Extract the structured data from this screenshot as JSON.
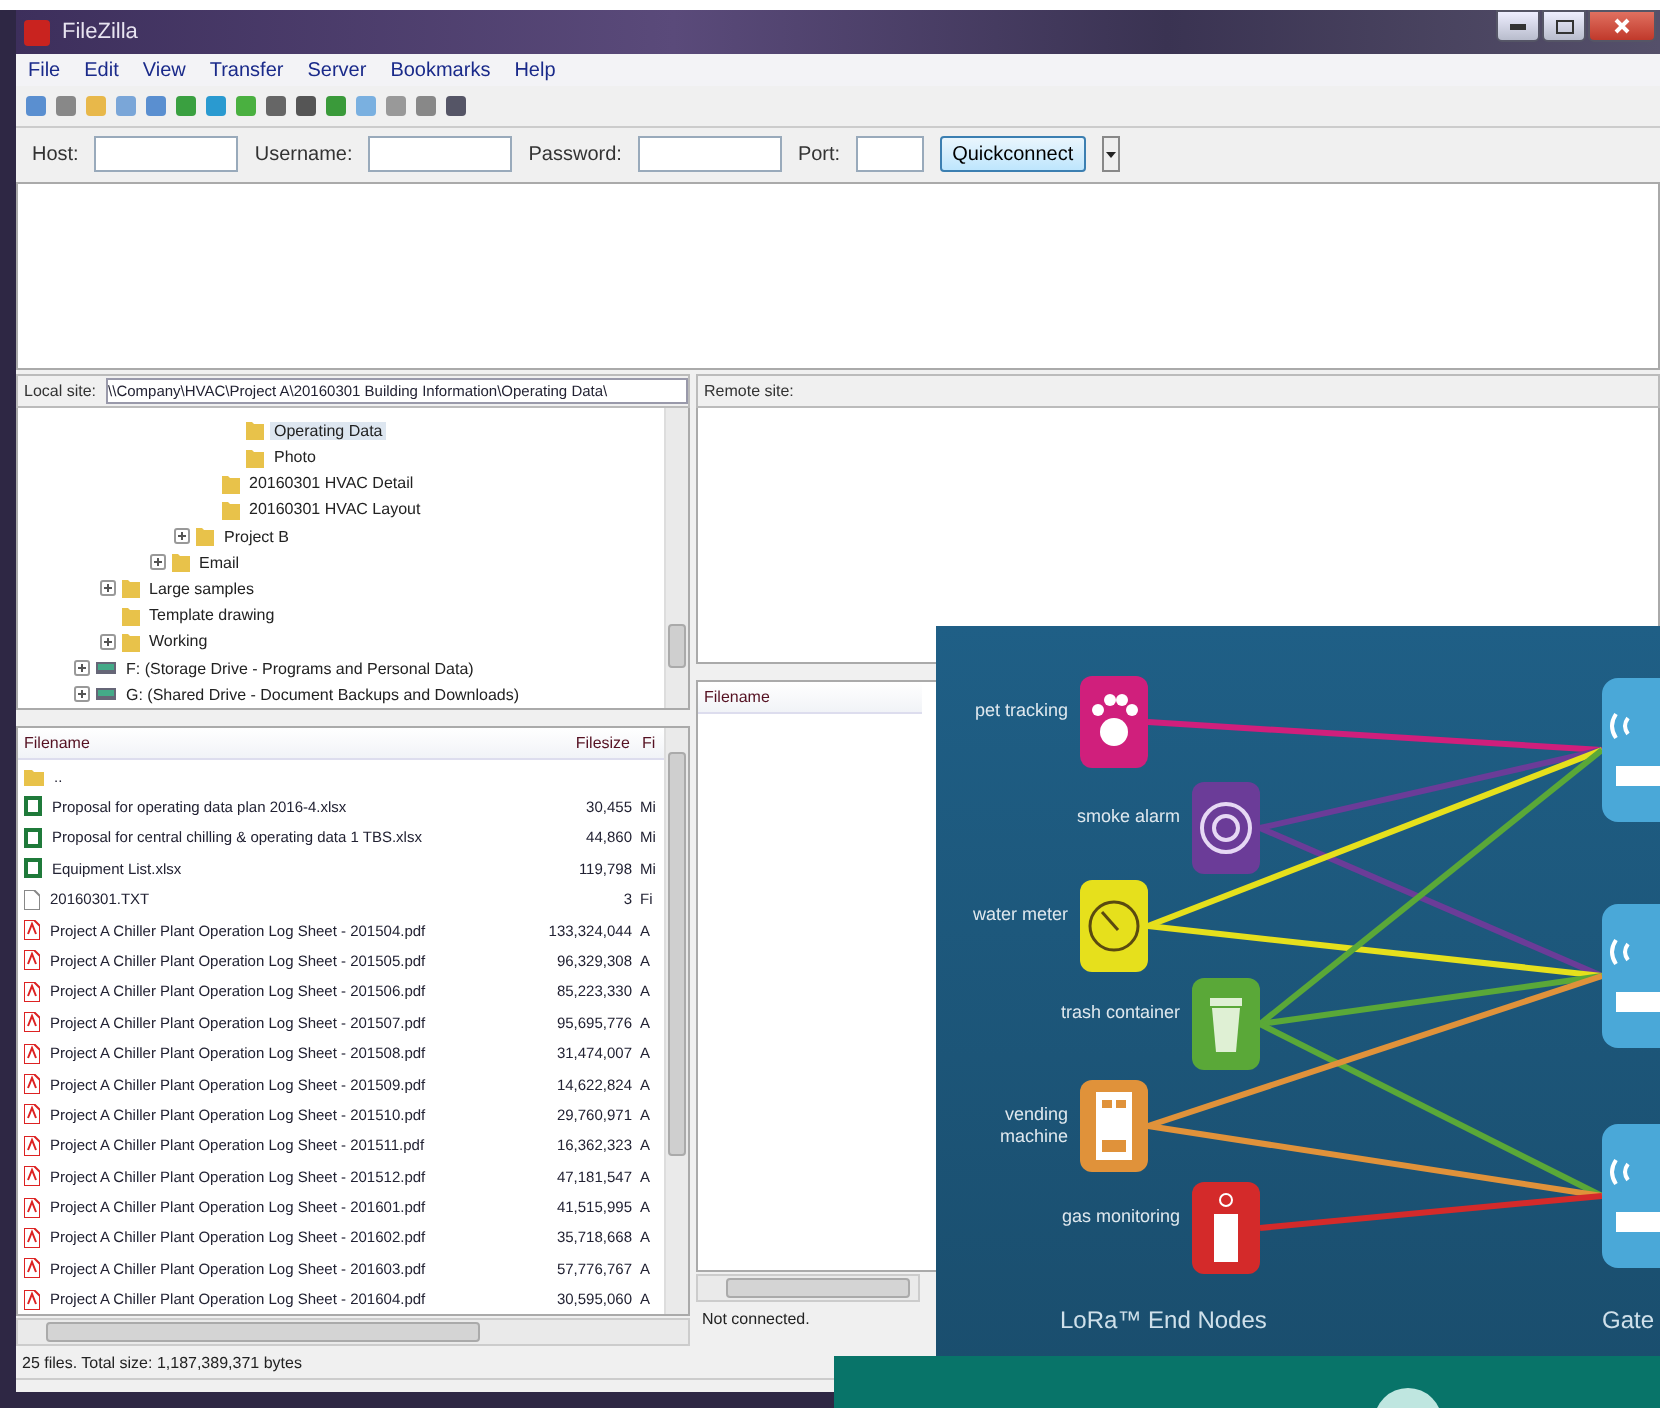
{
  "window": {
    "title": "FileZilla"
  },
  "menu": [
    "File",
    "Edit",
    "View",
    "Transfer",
    "Server",
    "Bookmarks",
    "Help"
  ],
  "quickconnect": {
    "fields": [
      {
        "label": "Host:",
        "kind": "text"
      },
      {
        "label": "Username:",
        "kind": "text"
      },
      {
        "label": "Password:",
        "kind": "text"
      },
      {
        "label": "Port:",
        "kind": "port"
      }
    ],
    "button": "Quickconnect"
  },
  "local_site": {
    "label": "Local site:",
    "path": "\\\\Company\\HVAC\\Project A\\20160301 Building Information\\Operating Data\\"
  },
  "tree": [
    {
      "children": [
        {
          "children": [
            {
              "children": [
                {
                  "children": [
                    {
                      "children": [
                        {
                          "children": [
                            {
                              "label": "Operating Data",
                              "selected": true
                            },
                            {
                              "label": "Photo",
                              "selected": false
                            }
                          ]
                        },
                        {
                          "label": "20160301 HVAC Detail",
                          "selected": false
                        },
                        {
                          "label": "20160301 HVAC Layout",
                          "selected": false
                        }
                      ]
                    },
                    {
                      "label": "Project B",
                      "selected": false,
                      "expanded": false
                    }
                  ]
                },
                {
                  "label": "Email",
                  "selected": false,
                  "expanded": false
                }
              ]
            }
          ]
        },
        {
          "label": "Large samples",
          "selected": false,
          "expanded": false
        },
        {
          "label": "Template drawing",
          "selected": false
        },
        {
          "label": "Working",
          "selected": false,
          "expanded": false
        }
      ]
    },
    {
      "label": "F: (Storage Drive - Programs and Personal Data)",
      "kind": "drive",
      "selected": false,
      "expanded": false
    },
    {
      "label": "G: (Shared Drive - Document Backups and Downloads)",
      "kind": "drive",
      "selected": false,
      "expanded": false
    }
  ],
  "local_files": {
    "columns": [
      "Filename",
      "Filesize",
      "Fi"
    ],
    "rows": [
      {
        "kind": "folder",
        "name": "..",
        "size": "",
        "type": ""
      },
      {
        "kind": "sheet",
        "name": "Proposal for operating data plan 2016-4.xlsx",
        "size": "30,455",
        "type": "Mi"
      },
      {
        "kind": "sheet",
        "name": "Proposal for central chilling & operating data 1 TBS.xlsx",
        "size": "44,860",
        "type": "Mi"
      },
      {
        "kind": "sheet",
        "name": "Equipment List.xlsx",
        "size": "119,798",
        "type": "Mi"
      },
      {
        "kind": "file",
        "name": "20160301.TXT",
        "size": "3",
        "type": "Fi"
      },
      {
        "kind": "pdf",
        "name": "Project A Chiller Plant Operation Log Sheet - 201504.pdf",
        "size": "133,324,044",
        "type": "A"
      },
      {
        "kind": "pdf",
        "name": "Project A Chiller Plant Operation Log Sheet - 201505.pdf",
        "size": "96,329,308",
        "type": "A"
      },
      {
        "kind": "pdf",
        "name": "Project A Chiller Plant Operation Log Sheet - 201506.pdf",
        "size": "85,223,330",
        "type": "A"
      },
      {
        "kind": "pdf",
        "name": "Project A Chiller Plant Operation Log Sheet - 201507.pdf",
        "size": "95,695,776",
        "type": "A"
      },
      {
        "kind": "pdf",
        "name": "Project A Chiller Plant Operation Log Sheet - 201508.pdf",
        "size": "31,474,007",
        "type": "A"
      },
      {
        "kind": "pdf",
        "name": "Project A Chiller Plant Operation Log Sheet - 201509.pdf",
        "size": "14,622,824",
        "type": "A"
      },
      {
        "kind": "pdf",
        "name": "Project A Chiller Plant Operation Log Sheet - 201510.pdf",
        "size": "29,760,971",
        "type": "A"
      },
      {
        "kind": "pdf",
        "name": "Project A Chiller Plant Operation Log Sheet - 201511.pdf",
        "size": "16,362,323",
        "type": "A"
      },
      {
        "kind": "pdf",
        "name": "Project A Chiller Plant Operation Log Sheet - 201512.pdf",
        "size": "47,181,547",
        "type": "A"
      },
      {
        "kind": "pdf",
        "name": "Project A Chiller Plant Operation Log Sheet - 201601.pdf",
        "size": "41,515,995",
        "type": "A"
      },
      {
        "kind": "pdf",
        "name": "Project A Chiller Plant Operation Log Sheet - 201602.pdf",
        "size": "35,718,668",
        "type": "A"
      },
      {
        "kind": "pdf",
        "name": "Project A Chiller Plant Operation Log Sheet - 201603.pdf",
        "size": "57,776,767",
        "type": "A"
      },
      {
        "kind": "pdf",
        "name": "Project A Chiller Plant Operation Log Sheet - 201604.pdf",
        "size": "30,595,060",
        "type": "A"
      }
    ]
  },
  "local_status": "25 files. Total size: 1,187,389,371 bytes",
  "remote_site": {
    "label": "Remote site:"
  },
  "remote_files": {
    "columns": [
      "Filename"
    ]
  },
  "remote_status": "Not connected.",
  "slide": {
    "nodes": [
      {
        "label": "pet tracking",
        "kind": "paw",
        "color": "#d01f7c"
      },
      {
        "label": "smoke alarm",
        "kind": "ring",
        "color": "#6b3c98"
      },
      {
        "label": "water meter",
        "kind": "gauge",
        "color": "#e6e01c"
      },
      {
        "label": "trash container",
        "kind": "bin",
        "color": "#5aa838"
      },
      {
        "label": "vending machine",
        "kind": "machine",
        "color": "#e0923a"
      },
      {
        "label": "gas monitoring",
        "kind": "tank",
        "color": "#d42a2a"
      }
    ],
    "nodes_title": "LoRa™ End Nodes",
    "gateways_title": "Gate"
  }
}
